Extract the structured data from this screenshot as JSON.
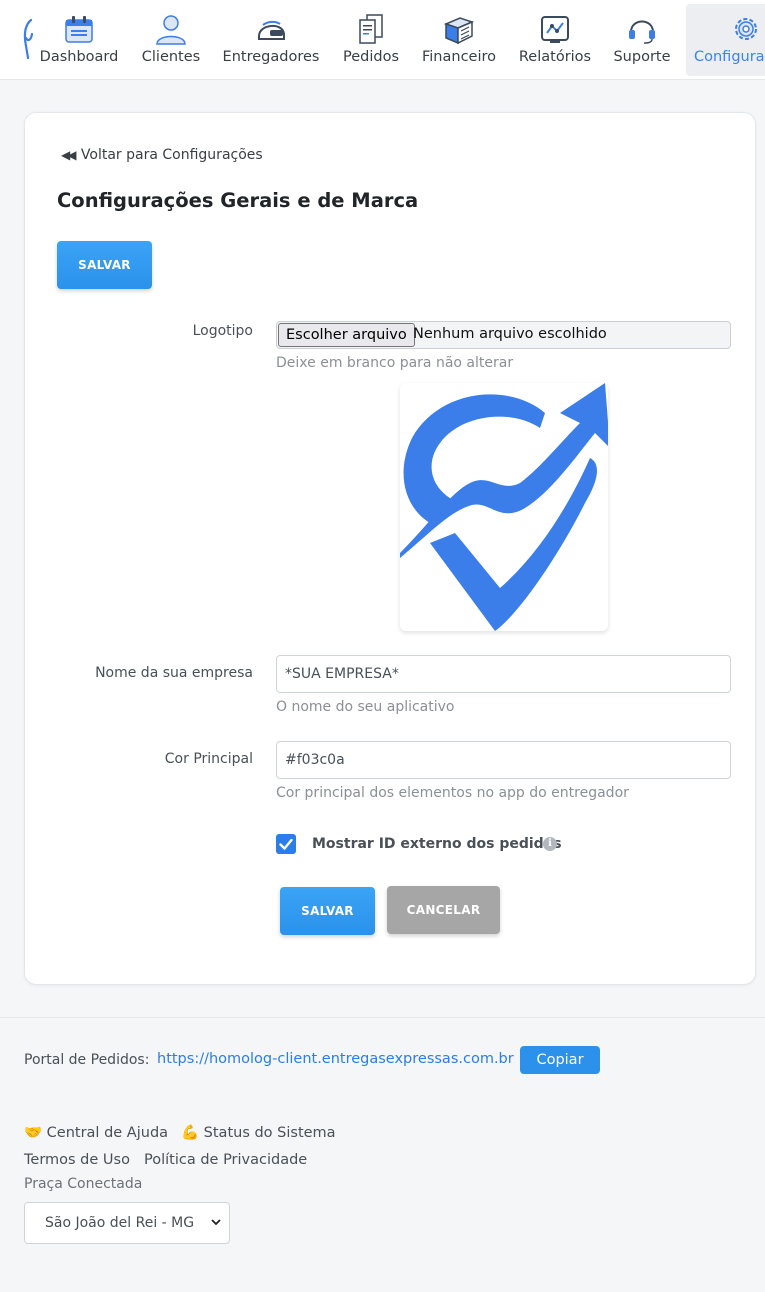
{
  "nav": {
    "items": [
      {
        "label": "Dashboard",
        "icon": "dashboard-calendar-icon"
      },
      {
        "label": "Clientes",
        "icon": "user-icon"
      },
      {
        "label": "Entregadores",
        "icon": "helmet-icon"
      },
      {
        "label": "Pedidos",
        "icon": "receipts-icon"
      },
      {
        "label": "Financeiro",
        "icon": "money-stack-icon"
      },
      {
        "label": "Relatórios",
        "icon": "chart-icon"
      },
      {
        "label": "Suporte",
        "icon": "headset-icon"
      },
      {
        "label": "Configura",
        "icon": "gear-icon"
      }
    ],
    "active": "Configura"
  },
  "page": {
    "back_link": "Voltar para Configurações",
    "title": "Configurações Gerais e de Marca",
    "save_top": "SALVAR"
  },
  "form": {
    "logo": {
      "label": "Logotipo",
      "file_button": "Escolher arquivo",
      "file_status": "Nenhum arquivo escolhido",
      "help": "Deixe em branco para não alterar"
    },
    "company": {
      "label": "Nome da sua empresa",
      "value": "*SUA EMPRESA*",
      "help": "O nome do seu aplicativo"
    },
    "color": {
      "label": "Cor Principal",
      "value": "#f03c0a",
      "help": "Cor principal dos elementos no app do entregador"
    },
    "external_id": {
      "label": "Mostrar ID externo dos pedidos",
      "checked": true,
      "info": "i"
    },
    "save": "SALVAR",
    "cancel": "CANCELAR"
  },
  "footer": {
    "portal_label": "Portal de Pedidos:",
    "portal_url": "https://homolog-client.entregasexpressas.com.br",
    "copy": "Copiar",
    "help_center": "🤝 Central de Ajuda",
    "system_status": "💪 Status do Sistema",
    "terms": "Termos de Uso",
    "privacy": "Política de Privacidade",
    "praca_label": "Praça Conectada",
    "praca_value": "São João del Rei - MG"
  },
  "colors": {
    "accent": "#2b91eb",
    "logo_blue": "#3b7de9",
    "checkbox": "#2b7de9",
    "cancel_gray": "#a6a6a6"
  }
}
